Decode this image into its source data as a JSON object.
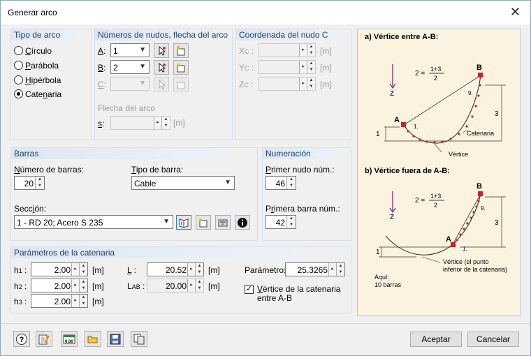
{
  "window": {
    "title": "Generar arco"
  },
  "arc_type": {
    "title": "Tipo de arco",
    "options": [
      {
        "pre": "",
        "key": "C",
        "post": "írculo"
      },
      {
        "pre": "",
        "key": "P",
        "post": "arábola"
      },
      {
        "pre": "",
        "key": "H",
        "post": "ipérbola"
      },
      {
        "pre": "Cate",
        "key": "n",
        "post": "aria"
      }
    ],
    "selected": "Catenaria"
  },
  "nodes": {
    "title": "Números de nudos, flecha del arco",
    "a_label": {
      "key": "A",
      "rest": ":"
    },
    "a_value": "1",
    "b_label": {
      "key": "B",
      "rest": ":"
    },
    "b_value": "2",
    "c_label": {
      "key": "C",
      "rest": ":"
    },
    "c_value": "",
    "sag_label": "Flecha del arco",
    "s_label": {
      "key": "s",
      "rest": ":"
    },
    "s_unit": "[m]"
  },
  "coord": {
    "title": "Coordenada del nudo C",
    "rows": [
      {
        "main": "X",
        "sub": "C",
        "unit": "[m]"
      },
      {
        "main": "Y",
        "sub": "C",
        "unit": "[m]"
      },
      {
        "main": "Z",
        "sub": "C",
        "unit": "[m]"
      }
    ]
  },
  "bars": {
    "title": "Barras",
    "count_label": {
      "key": "N",
      "rest": "úmero de barras:"
    },
    "count_value": "20",
    "type_label": {
      "key": "T",
      "rest": "ipo de barra:"
    },
    "type_value": "Cable",
    "section_label": {
      "pre": "Secc",
      "key": "i",
      "post": "ón:"
    },
    "section_value": "1 - RD 20; Acero S 235"
  },
  "numbering": {
    "title": "Numeración",
    "first_node_label": {
      "key": "P",
      "rest": "rimer nudo núm.:"
    },
    "first_node_value": "46",
    "first_bar_label": {
      "pre": "P",
      "key": "r",
      "post": "imera barra núm.:"
    },
    "first_bar_value": "42"
  },
  "params": {
    "title": "Parámetros de la catenaria",
    "h1": {
      "main": "h",
      "sub": "1",
      "value": "2.00",
      "unit": "[m]"
    },
    "h2": {
      "main": "h",
      "sub": "2",
      "value": "2.00",
      "unit": "[m]"
    },
    "h3": {
      "main": "h",
      "sub": "3",
      "value": "2.00",
      "unit": "[m]"
    },
    "L": {
      "main": "L",
      "value": "20.52",
      "unit": "[m]"
    },
    "LAB": {
      "main": "L",
      "sub": "AB",
      "value": "20.00",
      "unit": "[m]"
    },
    "param_label": "Parámetro:",
    "param_value": "25.3265",
    "vertex_label_pre": "V",
    "vertex_label_rest": "értice de la catenaria",
    "vertex_label_line2": "entre A-B",
    "vertex_checked": true
  },
  "diagram": {
    "a_title": "a) Vértice entre A-B:",
    "b_title": "b) Vértice fuera de A-B:",
    "formula_lhs": "2 =",
    "formula_num": "1+3",
    "formula_den": "2",
    "z": "Z",
    "A": "A",
    "B": "B",
    "n1": "1.",
    "n9": "9.",
    "h1": "1",
    "h3": "3",
    "catenaria": "Catenaria",
    "vertice": "Vértice",
    "vertice_b": [
      "Vértice (el punto",
      "inferior de la catenaria)"
    ],
    "aqui": [
      "Aquí:",
      "10 barras"
    ]
  },
  "footer": {
    "ok": "Aceptar",
    "cancel": "Cancelar"
  },
  "colors": {
    "accent": "#1e3f69",
    "diagram_bg": "#fbf3df",
    "curve_point": "#cc2222"
  }
}
